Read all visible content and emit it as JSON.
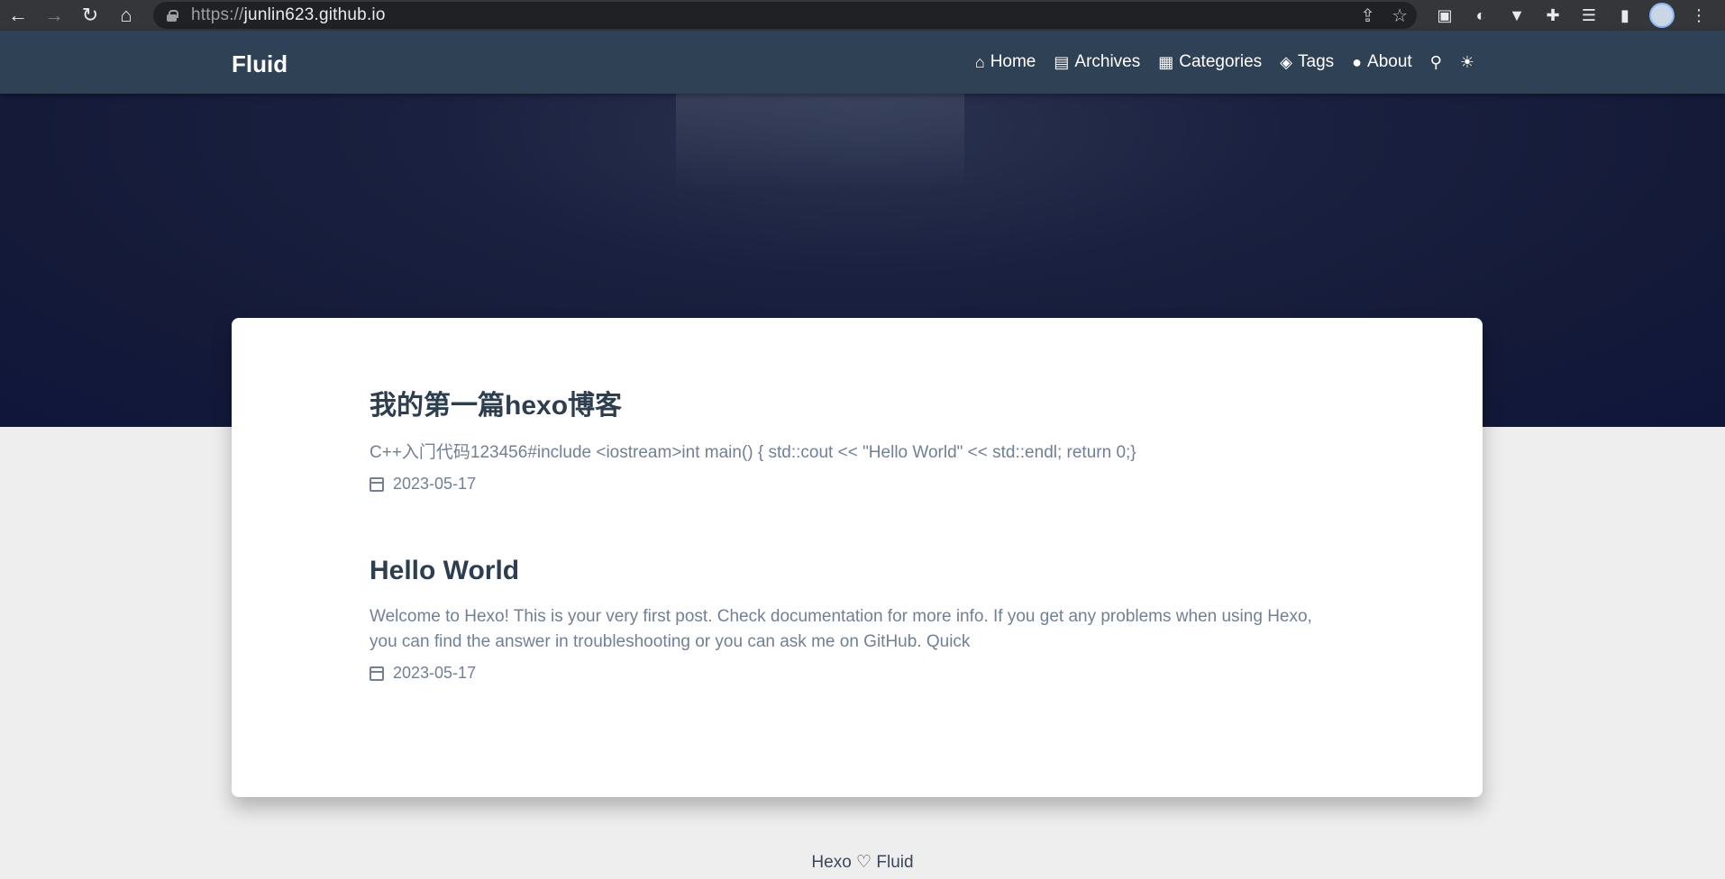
{
  "browser": {
    "url_scheme": "https://",
    "url_host": "junlin623.github.io",
    "icons": [
      "back-icon",
      "forward-icon",
      "reload-icon",
      "home-icon",
      "lock-icon",
      "share-icon",
      "star-icon",
      "extensions-icon",
      "reading-list-icon",
      "side-panel-icon",
      "menu-icon"
    ]
  },
  "site": {
    "brand": "Fluid",
    "menu": [
      {
        "label": "Home",
        "icon": "home-icon",
        "glyph": "⌂"
      },
      {
        "label": "Archives",
        "icon": "archive-icon",
        "glyph": "▤"
      },
      {
        "label": "Categories",
        "icon": "categories-icon",
        "glyph": "▦"
      },
      {
        "label": "Tags",
        "icon": "tags-icon",
        "glyph": "◈"
      },
      {
        "label": "About",
        "icon": "user-icon",
        "glyph": "●"
      }
    ],
    "search_glyph": "⚲",
    "theme_glyph": "☀"
  },
  "posts": [
    {
      "title": "我的第一篇hexo博客",
      "excerpt": "C++入门代码123456#include <iostream>int main() { std::cout << \"Hello World\" << std::endl; return 0;}",
      "date": "2023-05-17"
    },
    {
      "title": "Hello World",
      "excerpt": "Welcome to Hexo! This is your very first post. Check documentation for more info. If you get any problems when using Hexo, you can find the answer in troubleshooting or you can ask me on GitHub. Quick",
      "date": "2023-05-17"
    }
  ],
  "footer": {
    "text": "Hexo ♡ Fluid"
  },
  "colors": {
    "navbar": "#2f4154",
    "banner": "#141a38",
    "page_bg": "#eeeeee",
    "title": "#2c3e50",
    "excerpt": "#718096"
  }
}
